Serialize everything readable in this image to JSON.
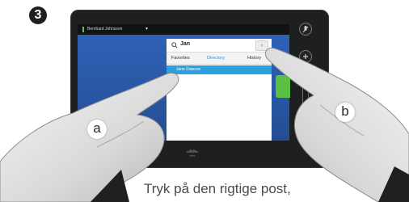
{
  "step": {
    "number": "3"
  },
  "device": {
    "status_bar": {
      "user_name": "Bernhard Johnsson"
    },
    "search": {
      "value": "Jan",
      "submit_label": "›"
    },
    "tabs": [
      {
        "label": "Favorites"
      },
      {
        "label": "Directory"
      },
      {
        "label": "History"
      }
    ],
    "selected_entry": "Jane Dawson",
    "brand": "cisco"
  },
  "callouts": {
    "a": "a",
    "b": "b"
  },
  "caption": "Tryk på den rigtige post,",
  "colors": {
    "screen_blue": "#2f63b8",
    "active_tab": "#3a8fd6",
    "selected_entry": "#2aa0de",
    "call_handle": "#5bbf43"
  },
  "icons": [
    "search-icon",
    "chevron-right-icon",
    "microphone-icon",
    "volume-up-icon",
    "volume-down-icon",
    "cisco-logo"
  ]
}
